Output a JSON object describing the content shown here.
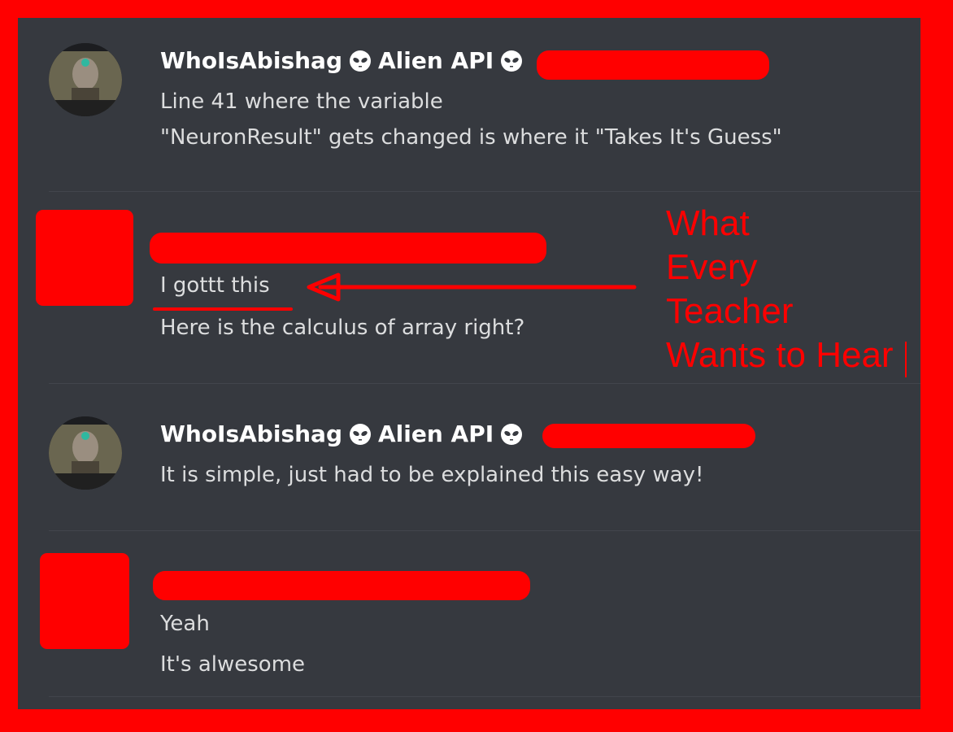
{
  "messages": [
    {
      "username": "WhoIsAbishag",
      "role": "Alien API",
      "icon": "alien-icon",
      "lines": [
        "Line 41 where the variable",
        "\"NeuronResult\" gets changed is where it \"Takes It's Guess\""
      ]
    },
    {
      "username": "",
      "redacted": true,
      "lines": [
        "I gottt this",
        "Here is the calculus of array right?"
      ]
    },
    {
      "username": "WhoIsAbishag",
      "role": "Alien API",
      "icon": "alien-icon",
      "lines": [
        "It is simple, just had to be explained this easy way!"
      ]
    },
    {
      "username": "",
      "redacted": true,
      "lines": [
        "Yeah",
        "It's alwesome"
      ]
    }
  ],
  "annotation": {
    "lines": [
      "What",
      "Every",
      "Teacher",
      "Wants to Hear"
    ],
    "color": "#ff0000"
  },
  "colors": {
    "background": "#36393f",
    "username": "#ffffff",
    "message_text": "#dcddde",
    "redaction": "#ff0000"
  }
}
